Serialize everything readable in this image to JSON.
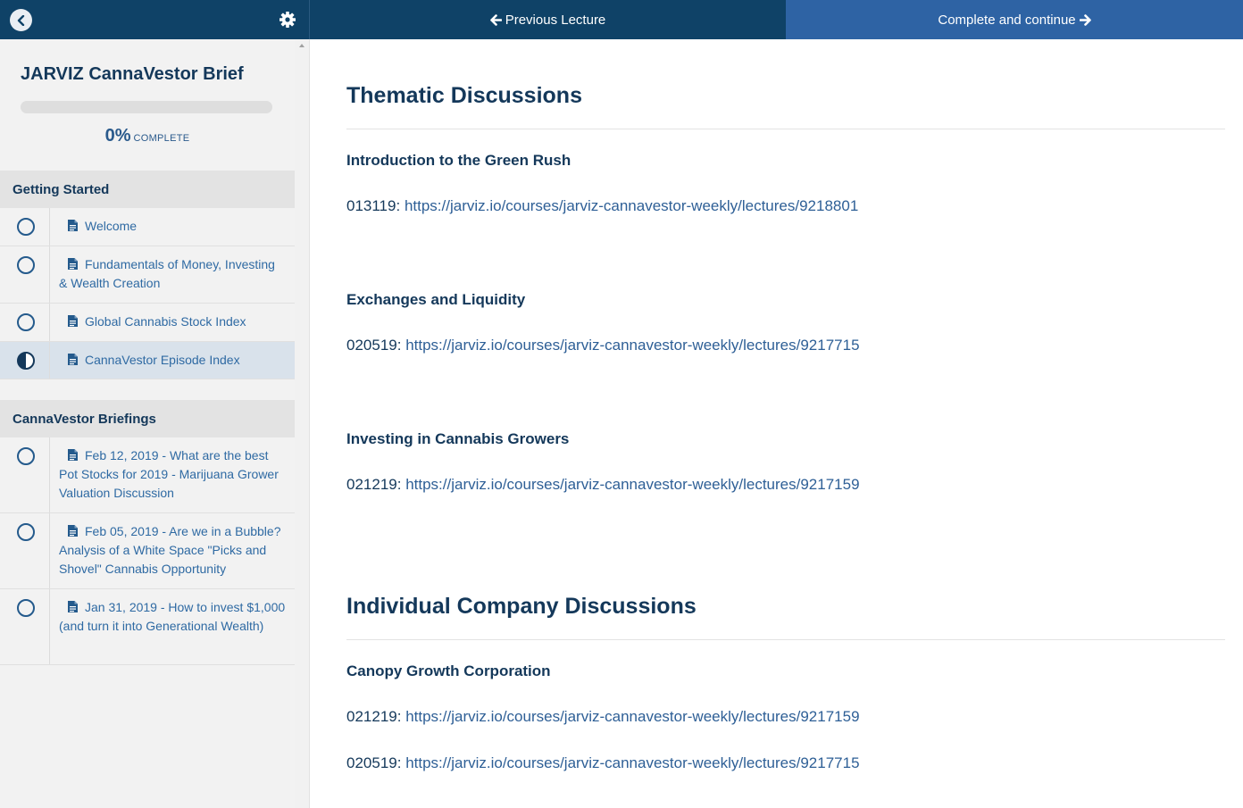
{
  "topbar": {
    "previous_label": "Previous Lecture",
    "complete_label": "Complete and continue",
    "colors": {
      "dark": "#0f4267",
      "accent": "#2e63a4"
    }
  },
  "sidebar": {
    "course_title": "JARVIZ CannaVestor Brief",
    "progress": {
      "fraction": 0.0,
      "percent_label": "0%",
      "word": "COMPLETE"
    },
    "sections": [
      {
        "title": "Getting Started",
        "lessons": [
          {
            "label": "Welcome",
            "status": "not-started"
          },
          {
            "label": "Fundamentals of Money, Investing & Wealth Creation",
            "status": "not-started"
          },
          {
            "label": "Global Cannabis Stock Index",
            "status": "not-started"
          },
          {
            "label": "CannaVestor Episode Index",
            "status": "in-progress"
          }
        ]
      },
      {
        "title": "CannaVestor Briefings",
        "lessons": [
          {
            "label": "Feb 12, 2019 - What are the best Pot Stocks for 2019 - Marijuana Grower Valuation Discussion",
            "status": "not-started"
          },
          {
            "label": "Feb 05, 2019 - Are we in a Bubble? Analysis of a White Space \"Picks and Shovel\" Cannabis Opportunity",
            "status": "not-started"
          },
          {
            "label": "Jan 31, 2019 - How to invest $1,000 (and turn it into Generational Wealth)",
            "status": "not-started"
          }
        ]
      }
    ]
  },
  "main": {
    "sections": [
      {
        "heading": "Thematic Discussions",
        "topics": [
          {
            "title": "Introduction to the Green Rush",
            "links": [
              {
                "code": "013119:",
                "url": "https://jarviz.io/courses/jarviz-cannavestor-weekly/lectures/9218801"
              }
            ]
          },
          {
            "title": "Exchanges and Liquidity",
            "links": [
              {
                "code": "020519:",
                "url": "https://jarviz.io/courses/jarviz-cannavestor-weekly/lectures/9217715"
              }
            ]
          },
          {
            "title": "Investing in Cannabis Growers",
            "links": [
              {
                "code": "021219:",
                "url": "https://jarviz.io/courses/jarviz-cannavestor-weekly/lectures/9217159"
              }
            ]
          }
        ]
      },
      {
        "heading": "Individual Company Discussions",
        "topics": [
          {
            "title": "Canopy Growth Corporation",
            "links": [
              {
                "code": "021219:",
                "url": "https://jarviz.io/courses/jarviz-cannavestor-weekly/lectures/9217159"
              },
              {
                "code": "020519:",
                "url": "https://jarviz.io/courses/jarviz-cannavestor-weekly/lectures/9217715"
              }
            ]
          }
        ]
      }
    ]
  }
}
